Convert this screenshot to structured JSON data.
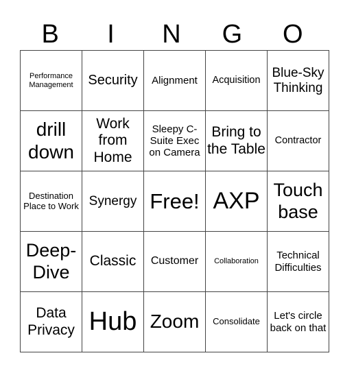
{
  "header": [
    "B",
    "I",
    "N",
    "G",
    "O"
  ],
  "rows": [
    [
      "Performance Management",
      "Security",
      "Alignment",
      "Acquisition",
      "Blue-Sky Thinking"
    ],
    [
      "drill down",
      "Work from Home",
      "Sleepy C-Suite Exec on Camera",
      "Bring to the Table",
      "Contractor"
    ],
    [
      "Destination Place to Work",
      "Synergy",
      "Free!",
      "AXP",
      "Touch base"
    ],
    [
      "Deep-Dive",
      "Classic",
      "Customer",
      "Collaboration",
      "Technical Difficulties"
    ],
    [
      "Data Privacy",
      "Hub",
      "Zoom",
      "Consolidate",
      "Let's circle back on that"
    ]
  ]
}
